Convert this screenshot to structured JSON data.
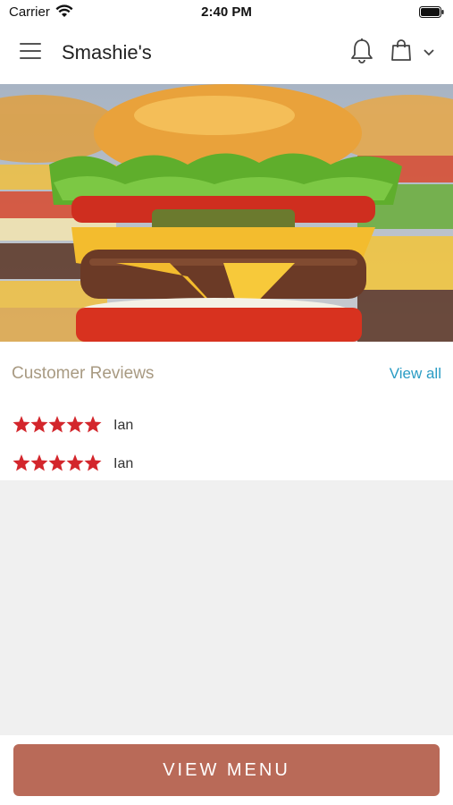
{
  "status_bar": {
    "carrier": "Carrier",
    "time": "2:40 PM"
  },
  "header": {
    "title": "Smashie's",
    "icons": [
      "menu-icon",
      "bell-icon",
      "shopping-bag-icon",
      "chevron-down-icon"
    ]
  },
  "hero": {
    "icon": "burger-image"
  },
  "reviews": {
    "title": "Customer Reviews",
    "view_all": "View all",
    "items": [
      {
        "name": "Ian",
        "rating": 5
      },
      {
        "name": "Ian",
        "rating": 5
      }
    ]
  },
  "footer": {
    "button_label": "VIEW MENU"
  },
  "colors": {
    "accent": "#b96a58",
    "link": "#2a9cc4",
    "star": "#d3262c",
    "section_title": "#a89a82"
  }
}
